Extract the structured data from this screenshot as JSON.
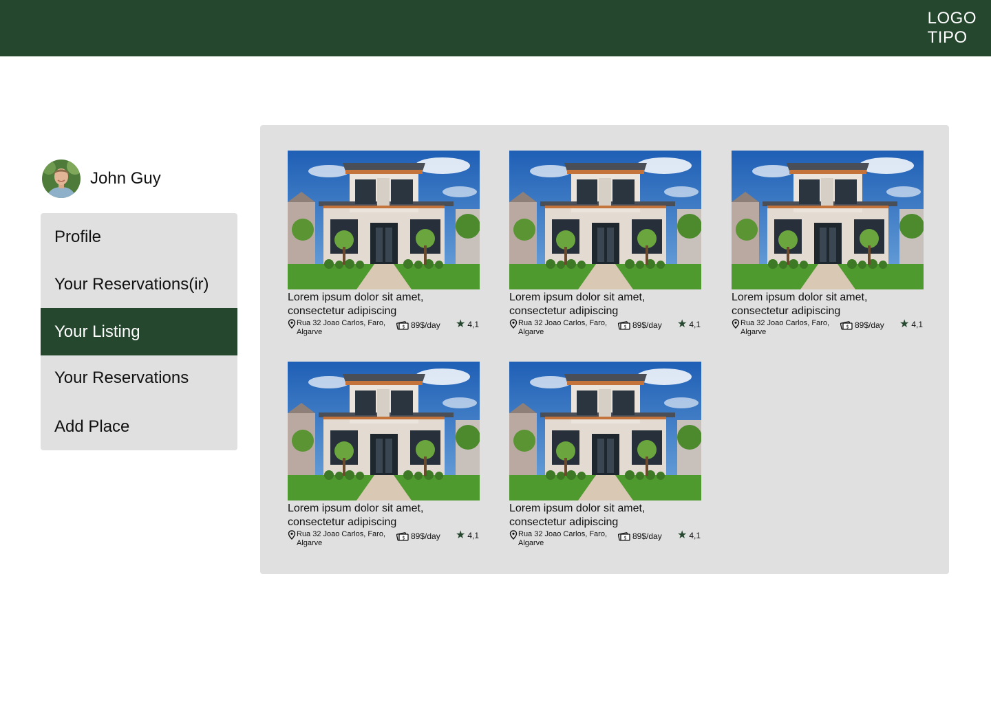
{
  "header": {
    "logo_line1": "LOGO",
    "logo_line2": "TIPO",
    "background": "#25472e"
  },
  "user": {
    "name": "John Guy",
    "avatar_icon": "user-photo"
  },
  "menu": {
    "items": [
      {
        "label": "Profile",
        "active": false
      },
      {
        "label": "Your Reservations(ir)",
        "active": false
      },
      {
        "label": "Your Listing",
        "active": true
      },
      {
        "label": "Your Reservations",
        "active": false
      },
      {
        "label": "Add Place",
        "active": false
      }
    ]
  },
  "listings": [
    {
      "title": "Lorem ipsum dolor sit amet, consectetur adipiscing",
      "address": "Rua 32 Joao Carlos, Faro, Algarve",
      "price": "89$/day",
      "rating": "4,1"
    },
    {
      "title": "Lorem ipsum dolor sit amet, consectetur adipiscing",
      "address": "Rua 32 Joao Carlos, Faro, Algarve",
      "price": "89$/day",
      "rating": "4,1"
    },
    {
      "title": "Lorem ipsum dolor sit amet, consectetur adipiscing",
      "address": "Rua 32 Joao Carlos, Faro, Algarve",
      "price": "89$/day",
      "rating": "4,1"
    },
    {
      "title": "Lorem ipsum dolor sit amet, consectetur adipiscing",
      "address": "Rua 32 Joao Carlos, Faro, Algarve",
      "price": "89$/day",
      "rating": "4,1"
    },
    {
      "title": "Lorem ipsum dolor sit amet, consectetur adipiscing",
      "address": "Rua 32 Joao Carlos, Faro, Algarve",
      "price": "89$/day",
      "rating": "4,1"
    }
  ],
  "colors": {
    "accent": "#25472e",
    "panel": "#e0e0e0"
  },
  "icons": {
    "location": "map-pin-icon",
    "price": "cash-icon",
    "rating": "star-icon"
  }
}
